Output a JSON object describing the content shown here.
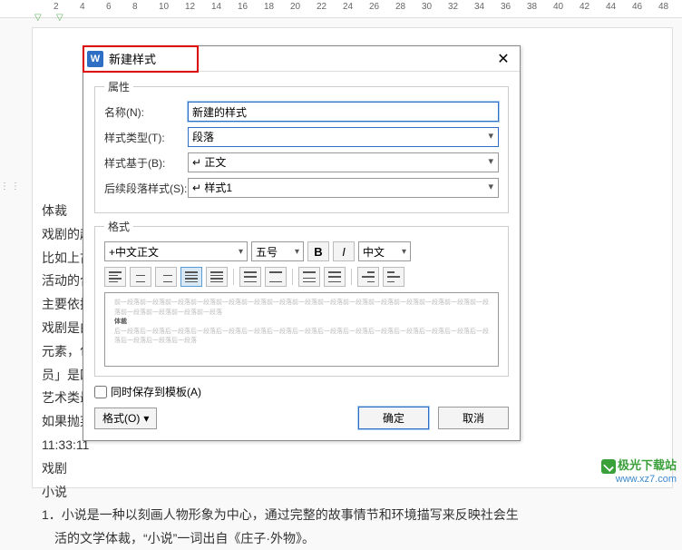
{
  "ruler": {
    "marks": [
      2,
      4,
      6,
      8,
      10,
      12,
      14,
      16,
      18,
      20,
      22,
      24,
      26,
      28,
      30,
      32,
      34,
      36,
      38,
      40,
      42,
      44,
      46,
      48
    ]
  },
  "document": {
    "lines": [
      "体裁",
      "戏剧的起　　　　　　　　　　　　　　　　　　　　　　　　　　　　巫术仪式，",
      "比如上古　　　　　　　　　　　　　　　　　　　　　　　　　　　　利的巫术",
      "活动的合　　　　　　　　　　　　　　　　　　　　　　　　　　　　这种说法",
      "主要依据",
      "戏剧是由　　　　　　　　　　　　　　　　　　　　　　　　　　　　戏剧有四个",
      "元素，包　　　　　　　　　　　　　　　　　　　　　　　　　　　　」。「演",
      "员」是四　　　　　　　　　　　　　　　　　　　　　　　　　　　　戏剧与其它",
      "艺术类最　　　　　　　　　　　　　　　　　　　　　　　　　　　　得以伸张，",
      "如果抛弃",
      "11:33:11",
      "戏剧",
      "小说",
      "1．小说是一种以刻画人物形象为中心，通过完整的故事情节和环境描写来反映社会生",
      "　活的文学体裁，“小说”一词出自《庄子·外物》。"
    ]
  },
  "dialog": {
    "title": "新建样式",
    "group_props": "属性",
    "group_format": "格式",
    "name_label": "名称(N):",
    "name_value": "新建的样式",
    "type_label": "样式类型(T):",
    "type_value": "段落",
    "based_label": "样式基于(B):",
    "based_value": "↵ 正文",
    "next_label": "后续段落样式(S):",
    "next_value": "↵ 样式1",
    "font_value": "+中文正文",
    "size_value": "五号",
    "lang_value": "中文",
    "bold": "B",
    "italic": "I",
    "save_template": "同时保存到模板(A)",
    "format_button": "格式(O)",
    "ok": "确定",
    "cancel": "取消",
    "preview_dim": "前一段落前一段落前一段落前一段落前一段落前一段落前一段落前一段落前一段落前一段落前一段落前一段落前一段落前一段落前一段落前一段落前一段落前一段落前一段落",
    "preview_bold": "体裁",
    "preview_after": "后一段落后一段落后一段落后一段落后一段落后一段落后一段落后一段落后一段落后一段落后一段落后一段落后一段落后一段落后一段落后一段落后一段落后一段落"
  },
  "watermark": {
    "line1": "极光下载站",
    "line2": "www.xz7.com"
  }
}
